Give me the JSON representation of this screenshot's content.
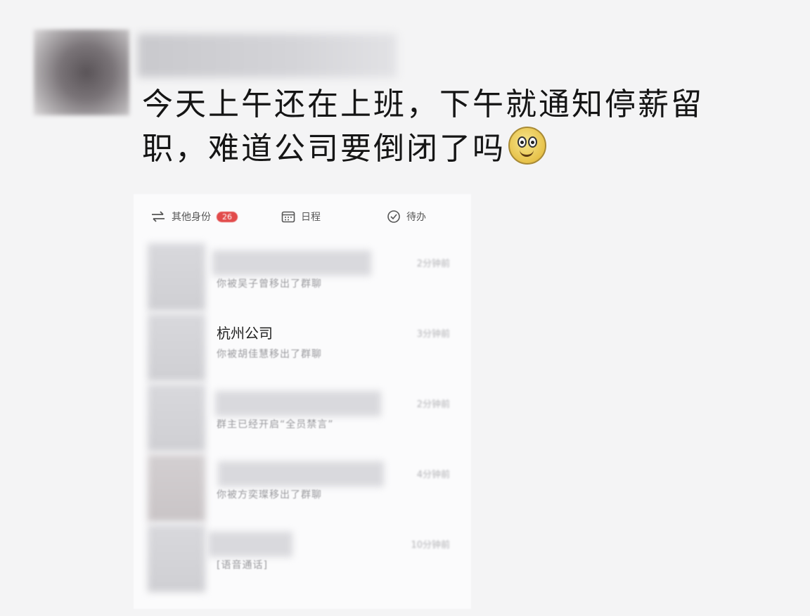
{
  "post": {
    "text": "今天上午还在上班，下午就通知停薪留职，难道公司要倒闭了吗"
  },
  "tabs": [
    {
      "label": "其他身份",
      "icon": "switch-arrows-icon",
      "badge": "26"
    },
    {
      "label": "日程",
      "icon": "calendar-icon"
    },
    {
      "label": "待办",
      "icon": "check-circle-icon"
    }
  ],
  "chats": [
    {
      "name": "",
      "sub": "你被吴子曾移出了群聊",
      "time": "2分钟前"
    },
    {
      "name": "杭州公司",
      "sub": "你被胡佳慧移出了群聊",
      "time": "3分钟前"
    },
    {
      "name": "",
      "sub": "群主已经开启“全员禁言”",
      "time": "2分钟前"
    },
    {
      "name": "",
      "sub": "你被方奕璨移出了群聊",
      "time": "4分钟前"
    },
    {
      "name": "",
      "sub": "[语音通话]",
      "time": "10分钟前"
    }
  ],
  "colors": {
    "badge": "#e24b4b",
    "text": "#151515"
  }
}
